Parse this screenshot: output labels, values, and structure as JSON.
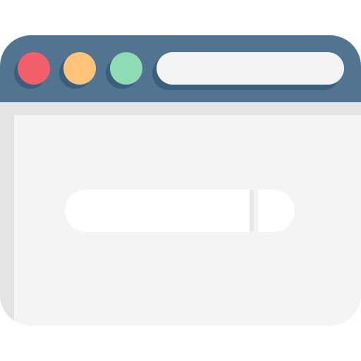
{
  "window": {
    "title_bar": {
      "controls": [
        {
          "name": "close",
          "color": "#f25f6b"
        },
        {
          "name": "minimize",
          "color": "#ffc37a"
        },
        {
          "name": "maximize",
          "color": "#8fdcb4"
        }
      ],
      "address_bar": {
        "text": ""
      }
    },
    "content": {
      "search": {
        "placeholder": "",
        "value": ""
      }
    }
  },
  "colors": {
    "title_bar": "#517590",
    "window_body": "#f4f4f4",
    "field": "#ffffff"
  }
}
